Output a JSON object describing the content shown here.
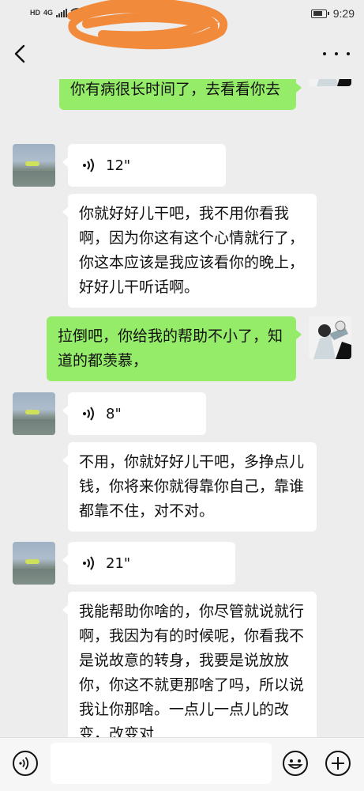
{
  "status_bar": {
    "left_text": "HD",
    "network": "4G",
    "time": "9:29"
  },
  "nav": {
    "back_icon": "chevron-left-icon",
    "more_icon": "more-dots-icon",
    "title_redacted": true
  },
  "messages": [
    {
      "side": "right",
      "type": "text",
      "text": "你有病很长时间了，去看看你去"
    },
    {
      "side": "left",
      "type": "voice",
      "duration": "12\""
    },
    {
      "side": "left",
      "type": "text",
      "text": "你就好好儿干吧，我不用你看我啊，因为你这有这个心情就行了，你这本应该是我应该看你的晚上，好好儿干听话啊。"
    },
    {
      "side": "right",
      "type": "text",
      "text": "拉倒吧，你给我的帮助不小了，知道的都羡慕，"
    },
    {
      "side": "left",
      "type": "voice",
      "duration": "8\""
    },
    {
      "side": "left",
      "type": "text",
      "text": "不用，你就好好儿干吧，多挣点儿钱，你将来你就得靠你自己，靠谁都靠不住，对不对。"
    },
    {
      "side": "left",
      "type": "voice",
      "duration": "21\""
    },
    {
      "side": "left",
      "type": "text",
      "text": "我能帮助你啥的，你尽管就说就行啊，我因为有的时候呢，你看我不是说故意的转身，我要是说放放你，你这不就更那啥了吗，所以说我让你那啥。一点儿一点儿的改变，改变对"
    }
  ],
  "input_bar": {
    "voice_icon": "voice-input-icon",
    "placeholder": "",
    "emoji_icon": "emoji-icon",
    "plus_icon": "plus-icon"
  },
  "colors": {
    "background": "#ededed",
    "bubble_self": "#95ec69",
    "bubble_other": "#ffffff",
    "scribble": "#f28a3c"
  }
}
